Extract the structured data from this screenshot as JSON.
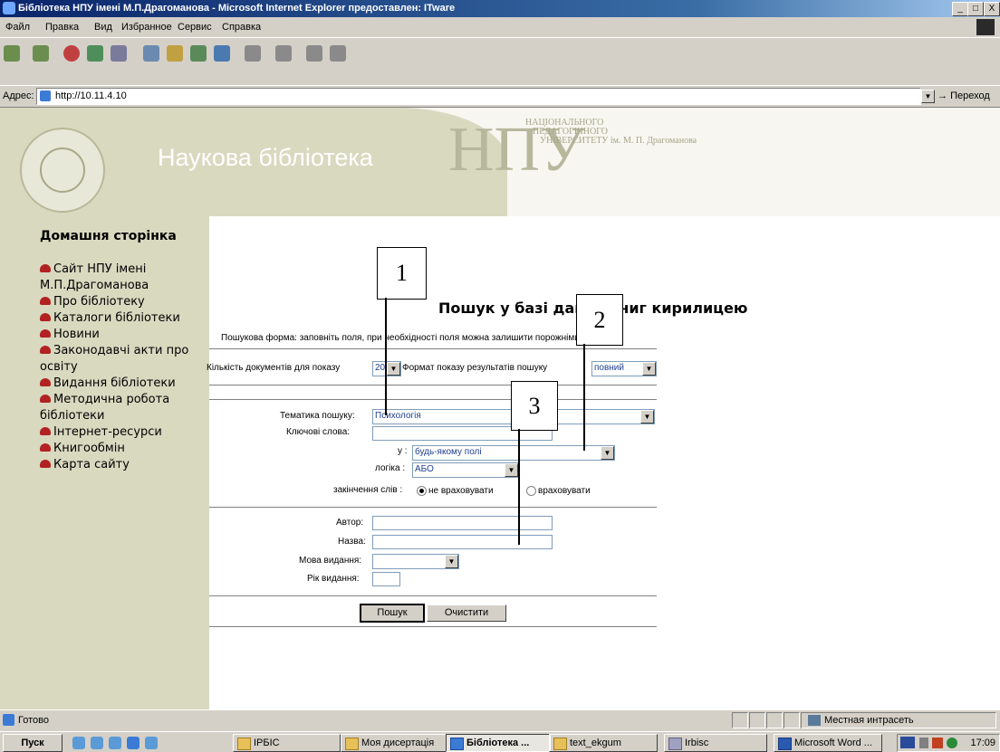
{
  "window": {
    "title": "Бібліотека НПУ імені М.П.Драгоманова - Microsoft Internet Explorer предоставлен: ITware",
    "min": "_",
    "max": "□",
    "close": "X"
  },
  "menu": [
    "Файл",
    "Правка",
    "Вид",
    "Избранное",
    "Сервис",
    "Справка"
  ],
  "address": {
    "label": "Адрес:",
    "url": "http://10.11.4.10",
    "go": "Переход"
  },
  "site": {
    "title": "Наукова бібліотека",
    "npu_letters": "НПУ",
    "npu_line1": "НАЦІОНАЛЬНОГО",
    "npu_line2": "ПЕДАГОГІЧНОГО",
    "npu_line3": "УНІВЕРСИТЕТУ ім. М. П. Драгоманова"
  },
  "sidebar": {
    "home": "Домашня сторінка",
    "items": [
      "Сайт НПУ імені М.П.Драгоманова",
      "Про бібліотеку",
      "Каталоги бібліотеки",
      "Новини",
      "Законодавчі акти про освіту",
      "Видання бібліотеки",
      "Методична робота бібліотеки",
      "Інтернет-ресурси",
      "Книгообмін",
      "Карта сайту"
    ]
  },
  "form": {
    "title": "Пошук у базі даних книг кирилицею",
    "hint": "Пошукова форма: заповніть поля, при необхідності поля можна залишити порожніми.",
    "count_label": "Кількість документів для показу",
    "count_value": "20",
    "format_label": "Формат показу результатів пошуку",
    "format_value": "повний",
    "topic_label": "Тематика пошуку:",
    "topic_value": "Психологія",
    "keywords_label": "Ключові слова:",
    "in_label": "у :",
    "in_value": "будь-якому полі",
    "logic_label": "логіка :",
    "logic_value": "АБО",
    "endings_label": "закінчення слів :",
    "opt_ignore": "не враховувати",
    "opt_consider": "враховувати",
    "author_label": "Автор:",
    "name_label": "Назва:",
    "lang_label": "Мова видання:",
    "year_label": "Рік видання:",
    "search_btn": "Пошук",
    "clear_btn": "Очистити"
  },
  "callouts": [
    "1",
    "2",
    "3"
  ],
  "status": {
    "text": "Готово",
    "zone": "Местная интрасеть"
  },
  "taskbar": {
    "start": "Пуск",
    "tasks": [
      "IPБIC",
      "Моя дисертація",
      "Бібліотека ...",
      "text_ekgum",
      "Irbisc",
      "Microsoft Word ..."
    ],
    "clock": "17:09"
  }
}
